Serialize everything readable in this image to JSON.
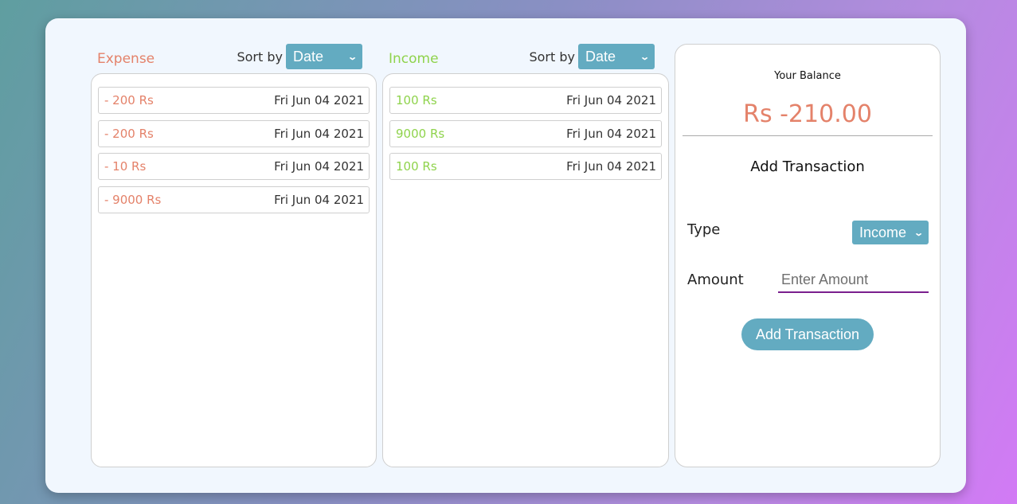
{
  "expense": {
    "title": "Expense",
    "sort_label": "Sort by",
    "sort_value": "Date",
    "items": [
      {
        "amount": "- 200 Rs",
        "date": "Fri Jun 04 2021"
      },
      {
        "amount": "- 200 Rs",
        "date": "Fri Jun 04 2021"
      },
      {
        "amount": "- 10 Rs",
        "date": "Fri Jun 04 2021"
      },
      {
        "amount": "- 9000 Rs",
        "date": "Fri Jun 04 2021"
      }
    ]
  },
  "income": {
    "title": "Income",
    "sort_label": "Sort by",
    "sort_value": "Date",
    "items": [
      {
        "amount": "100 Rs",
        "date": "Fri Jun 04 2021"
      },
      {
        "amount": "9000 Rs",
        "date": "Fri Jun 04 2021"
      },
      {
        "amount": "100 Rs",
        "date": "Fri Jun 04 2021"
      }
    ]
  },
  "balance": {
    "label": "Your Balance",
    "value": "Rs -210.00"
  },
  "form": {
    "title": "Add Transaction",
    "type_label": "Type",
    "type_value": "Income",
    "amount_label": "Amount",
    "amount_placeholder": "Enter Amount",
    "amount_value": "",
    "submit_label": "Add Transaction"
  },
  "colors": {
    "expense": "#e4826a",
    "income": "#8fd34c",
    "accent": "#63abc1",
    "input_underline": "#7a1f8e"
  }
}
